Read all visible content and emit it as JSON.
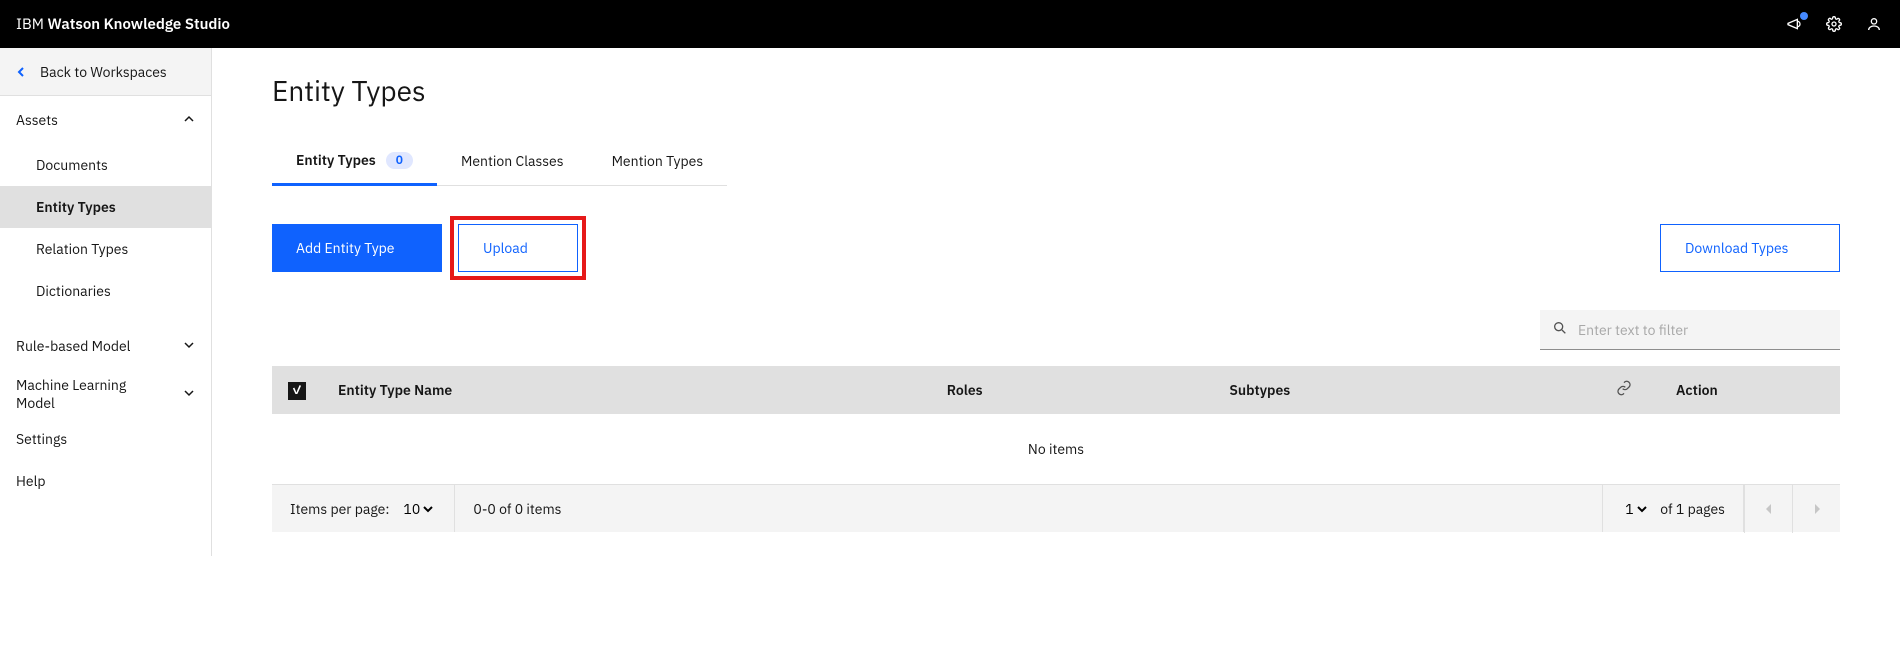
{
  "header": {
    "brand_prefix": "IBM",
    "brand_name": "Watson Knowledge Studio"
  },
  "sidebar": {
    "back_label": "Back to Workspaces",
    "sections": {
      "assets": {
        "label": "Assets",
        "items": [
          "Documents",
          "Entity Types",
          "Relation Types",
          "Dictionaries"
        ],
        "active_index": 1
      },
      "rule_model": {
        "label": "Rule-based Model"
      },
      "ml_model": {
        "label": "Machine Learning Model"
      },
      "settings": {
        "label": "Settings"
      },
      "help": {
        "label": "Help"
      }
    }
  },
  "page": {
    "title": "Entity Types",
    "tabs": [
      {
        "label": "Entity Types",
        "count": "0",
        "active": true
      },
      {
        "label": "Mention Classes",
        "active": false
      },
      {
        "label": "Mention Types",
        "active": false
      }
    ],
    "actions": {
      "add": "Add Entity Type",
      "upload": "Upload",
      "download": "Download Types"
    },
    "search_placeholder": "Enter text to filter",
    "table": {
      "columns": [
        "Entity Type Name",
        "Roles",
        "Subtypes"
      ],
      "link_col_icon": "link",
      "action_col": "Action",
      "no_items": "No items"
    },
    "pagination": {
      "items_per_page_label": "Items per page:",
      "items_per_page_value": "10",
      "range_text": "0-0 of 0 items",
      "page_value": "1",
      "pages_text": "of 1 pages"
    }
  }
}
